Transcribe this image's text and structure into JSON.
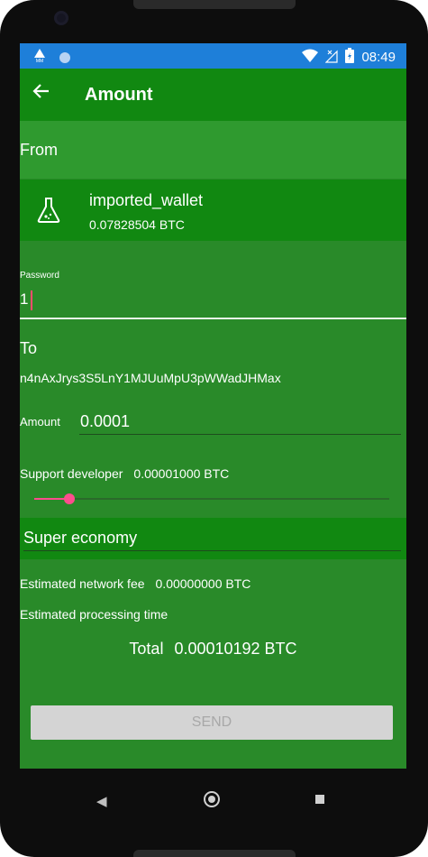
{
  "status_bar": {
    "time": "08:49",
    "icons": [
      "signal-mm-icon",
      "sync-dot-icon",
      "wifi-icon",
      "no-sim-icon",
      "battery-icon"
    ]
  },
  "app_bar": {
    "title": "Amount",
    "back_icon": "arrow-left-icon"
  },
  "from": {
    "label": "From",
    "wallet": {
      "name": "imported_wallet",
      "balance": "0.07828504 BTC",
      "icon": "flask-icon"
    }
  },
  "password": {
    "label": "Password",
    "value": "1"
  },
  "to": {
    "label": "To",
    "address": "n4nAxJrys3S5LnY1MJUuMpU3pWWadJHMax"
  },
  "amount": {
    "label": "Amount",
    "value": "0.0001"
  },
  "support_developer": {
    "label": "Support developer",
    "value": "0.00001000 BTC",
    "slider_level": 0.1
  },
  "speed": {
    "selected": "Super economy"
  },
  "fee": {
    "label": "Estimated network fee",
    "value": "0.00000000 BTC"
  },
  "processing_time": {
    "label": "Estimated processing time"
  },
  "total": {
    "label": "Total",
    "value": "0.00010192 BTC"
  },
  "send_button": {
    "label": "SEND"
  },
  "colors": {
    "status_bar": "#1e7fd9",
    "app_bar": "#118811",
    "background": "#298a29",
    "accent": "#ff4d8d",
    "button_disabled": "#d4d4d4"
  }
}
